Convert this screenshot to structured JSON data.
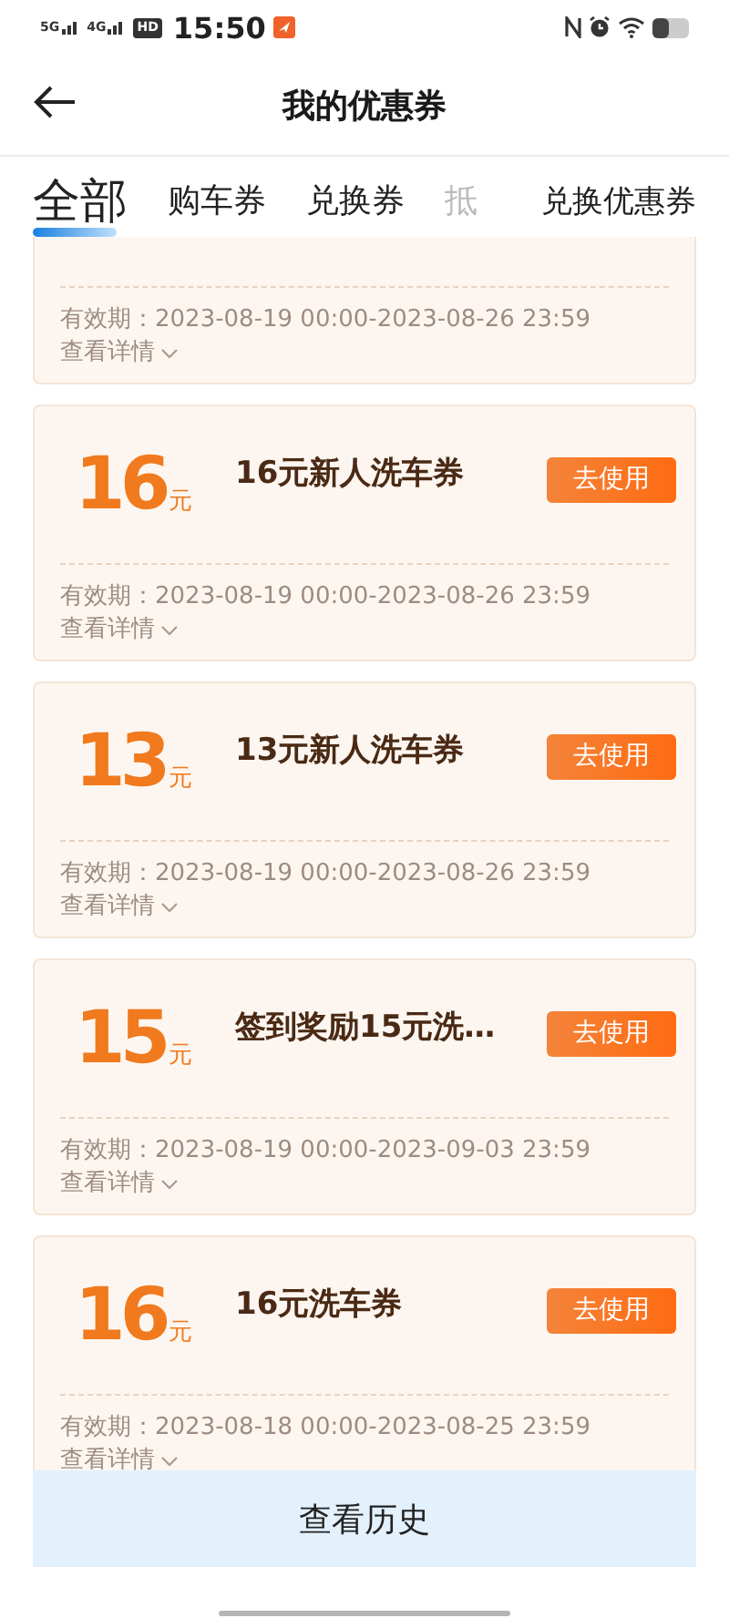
{
  "status_bar": {
    "networks": [
      "5G",
      "4G"
    ],
    "hd": "HD",
    "time": "15:50"
  },
  "header": {
    "title": "我的优惠券"
  },
  "tabs": [
    {
      "label": "全部",
      "selected": true,
      "faded": false
    },
    {
      "label": "购车券",
      "selected": false,
      "faded": false
    },
    {
      "label": "兑换券",
      "selected": false,
      "faded": false
    },
    {
      "label": "抵",
      "selected": false,
      "faded": true
    }
  ],
  "redeem_link": "兑换优惠券",
  "coupons": [
    {
      "kind": "partial",
      "validity": "有效期：2023-08-19 00:00-2023-08-26 23:59",
      "details": "查看详情"
    },
    {
      "kind": "full",
      "amount": "16",
      "unit": "元",
      "title": "16元新人洗车券",
      "action": "去使用",
      "validity": "有效期：2023-08-19 00:00-2023-08-26 23:59",
      "details": "查看详情"
    },
    {
      "kind": "full",
      "amount": "13",
      "unit": "元",
      "title": "13元新人洗车券",
      "action": "去使用",
      "validity": "有效期：2023-08-19 00:00-2023-08-26 23:59",
      "details": "查看详情"
    },
    {
      "kind": "full",
      "amount": "15",
      "unit": "元",
      "title": "签到奖励15元洗…",
      "action": "去使用",
      "validity": "有效期：2023-08-19 00:00-2023-09-03 23:59",
      "details": "查看详情"
    },
    {
      "kind": "full",
      "amount": "16",
      "unit": "元",
      "title": "16元洗车券",
      "action": "去使用",
      "validity": "有效期：2023-08-18 00:00-2023-08-25 23:59",
      "details": "查看详情"
    }
  ],
  "history_button": "查看历史"
}
